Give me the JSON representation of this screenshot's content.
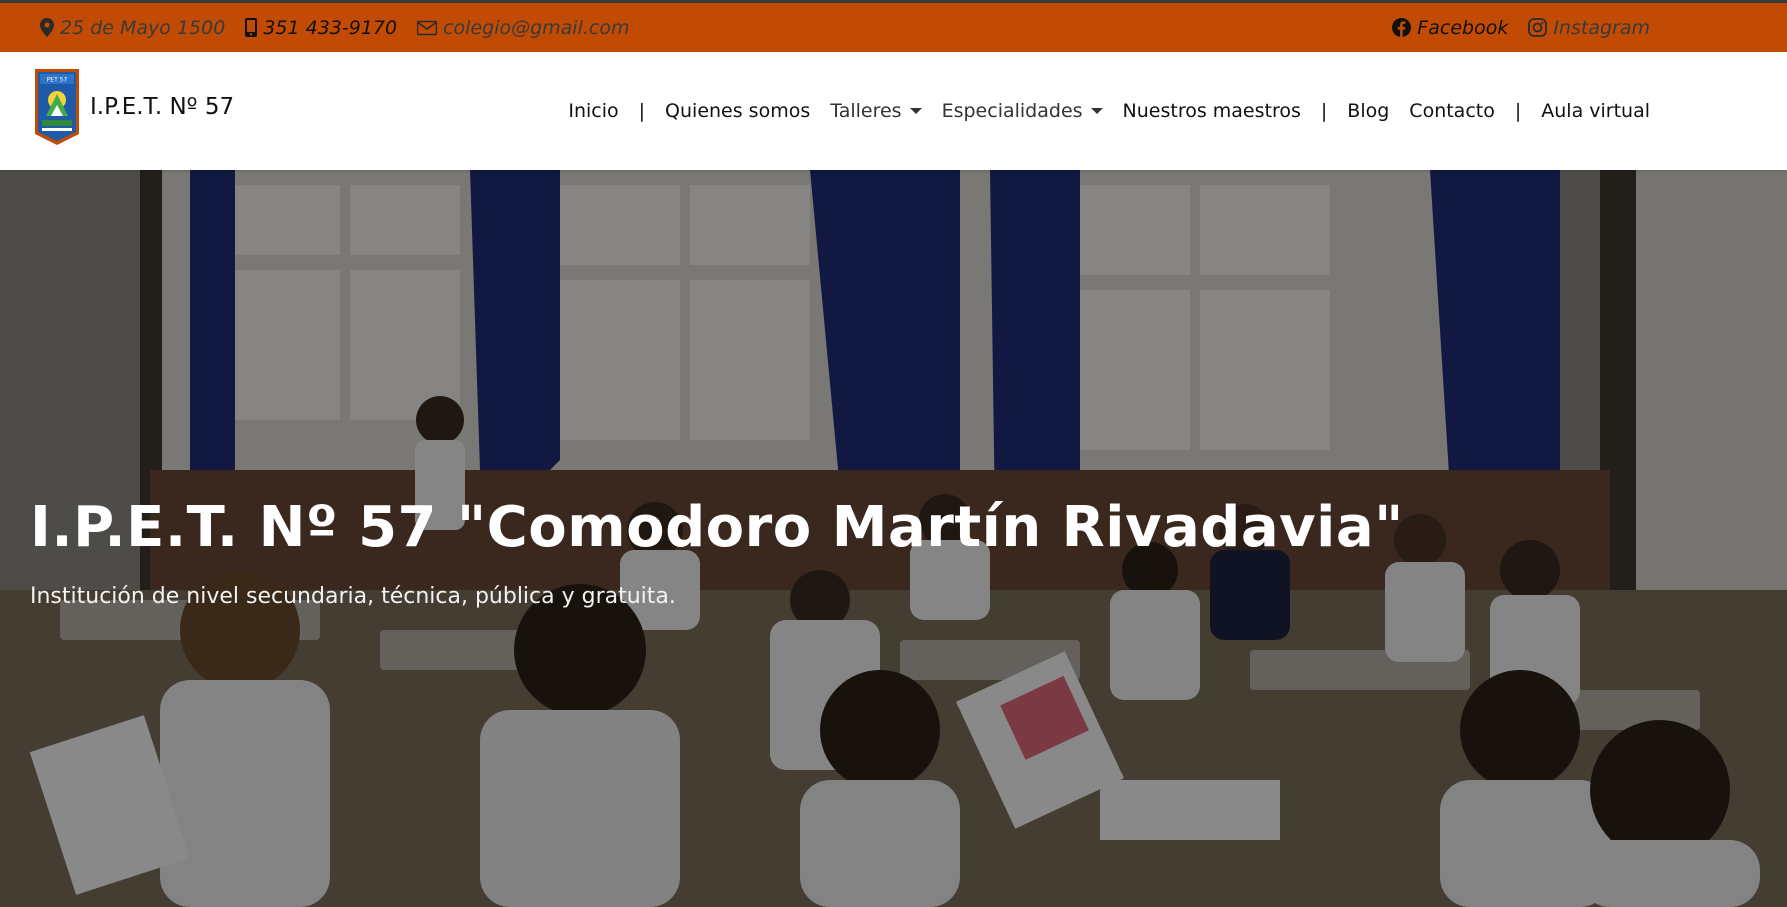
{
  "colors": {
    "topbar_bg": "#c24b04",
    "navbar_bg": "#ffffff",
    "hero_overlay": "#000000",
    "hero_text": "#ffffff"
  },
  "topbar": {
    "address": {
      "icon": "map-pin-icon",
      "text": "25 de Mayo 1500"
    },
    "phone": {
      "icon": "phone-icon",
      "text": "351 433-9170"
    },
    "email": {
      "icon": "envelope-icon",
      "text": "colegio@gmail.com"
    },
    "facebook": {
      "icon": "facebook-icon",
      "text": "Facebook"
    },
    "instagram": {
      "icon": "instagram-icon",
      "text": "Instagram"
    }
  },
  "brand": {
    "logo_icon": "school-crest-logo",
    "name": "I.P.E.T. Nº 57"
  },
  "nav": {
    "separator": "|",
    "items": [
      {
        "label": "Inicio"
      },
      {
        "label": "Quienes somos"
      },
      {
        "label": "Talleres",
        "dropdown": true
      },
      {
        "label": "Especialidades",
        "dropdown": true
      },
      {
        "label": "Nuestros maestros"
      },
      {
        "label": "Blog"
      },
      {
        "label": "Contacto"
      },
      {
        "label": "Aula virtual"
      }
    ]
  },
  "hero": {
    "image": "classroom-students-photo",
    "title": "I.P.E.T. Nº 57 \"Comodoro Martín Rivadavia\"",
    "subtitle": "Institución de nivel secundaria, técnica, pública y gratuita."
  }
}
